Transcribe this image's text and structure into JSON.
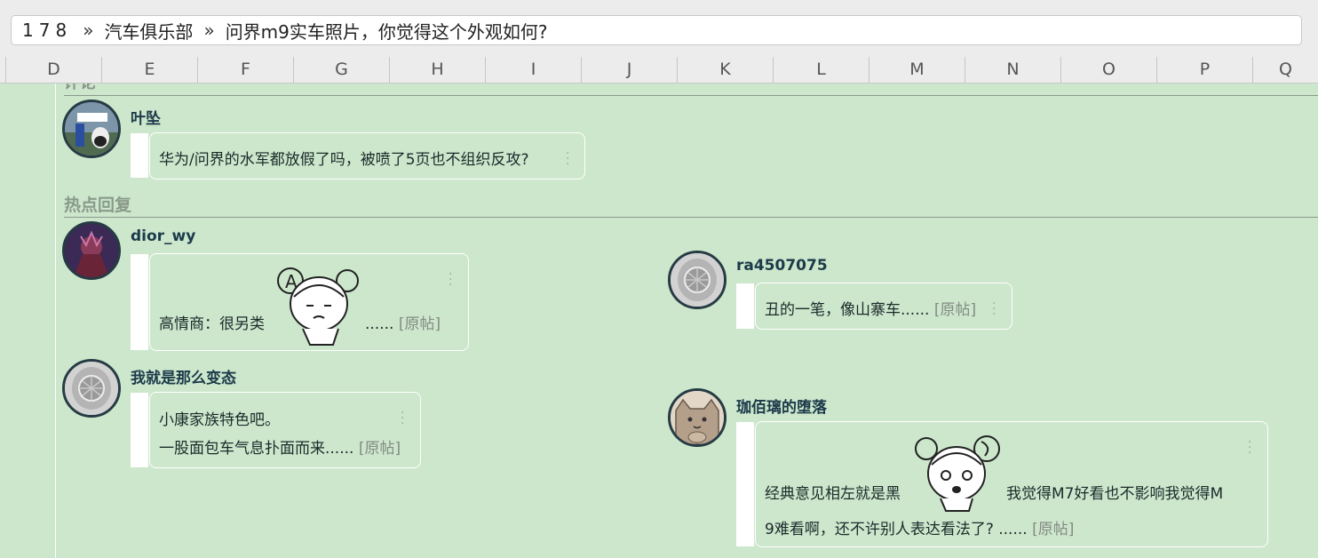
{
  "breadcrumb": {
    "page": "178",
    "forum": "汽车俱乐部",
    "thread": "问界m9实车照片，你觉得这个外观如何?",
    "separator": "»"
  },
  "columns": [
    "D",
    "E",
    "F",
    "G",
    "H",
    "I",
    "J",
    "K",
    "L",
    "M",
    "N",
    "O",
    "P",
    "Q"
  ],
  "sections": {
    "partial_title": "评论",
    "hot_replies_title": "热点回复"
  },
  "posts": {
    "p1": {
      "user": "叶坠",
      "text": "华为/问界的水军都放假了吗，被喷了5页也不组织反攻?"
    },
    "p2": {
      "user": "dior_wy",
      "text_before": "高情商：很另类",
      "text_after": "......",
      "orig": "[原帖]"
    },
    "p3": {
      "user": "ra4507075",
      "text": "丑的一笔，像山寨车......",
      "orig": "[原帖]"
    },
    "p4": {
      "user": "我就是那么变态",
      "line1": "小康家族特色吧。",
      "line2": "一股面包车气息扑面而来......",
      "orig": "[原帖]"
    },
    "p5": {
      "user": "珈佰璃的堕落",
      "line1_before": "经典意见相左就是黑",
      "line1_after": "我觉得M7好看也不影响我觉得M",
      "line2": "9难看啊，还不许别人表达看法了? ......",
      "orig": "[原帖]"
    }
  },
  "icons": {
    "menu": "vertical-ellipsis-icon",
    "avatar_default": "default-avatar-icon",
    "sticker": "anime-girl-sticker-icon"
  },
  "colors": {
    "background": "#cce7cc",
    "username": "#1d3a4a",
    "section_title": "#8a9a8a"
  }
}
